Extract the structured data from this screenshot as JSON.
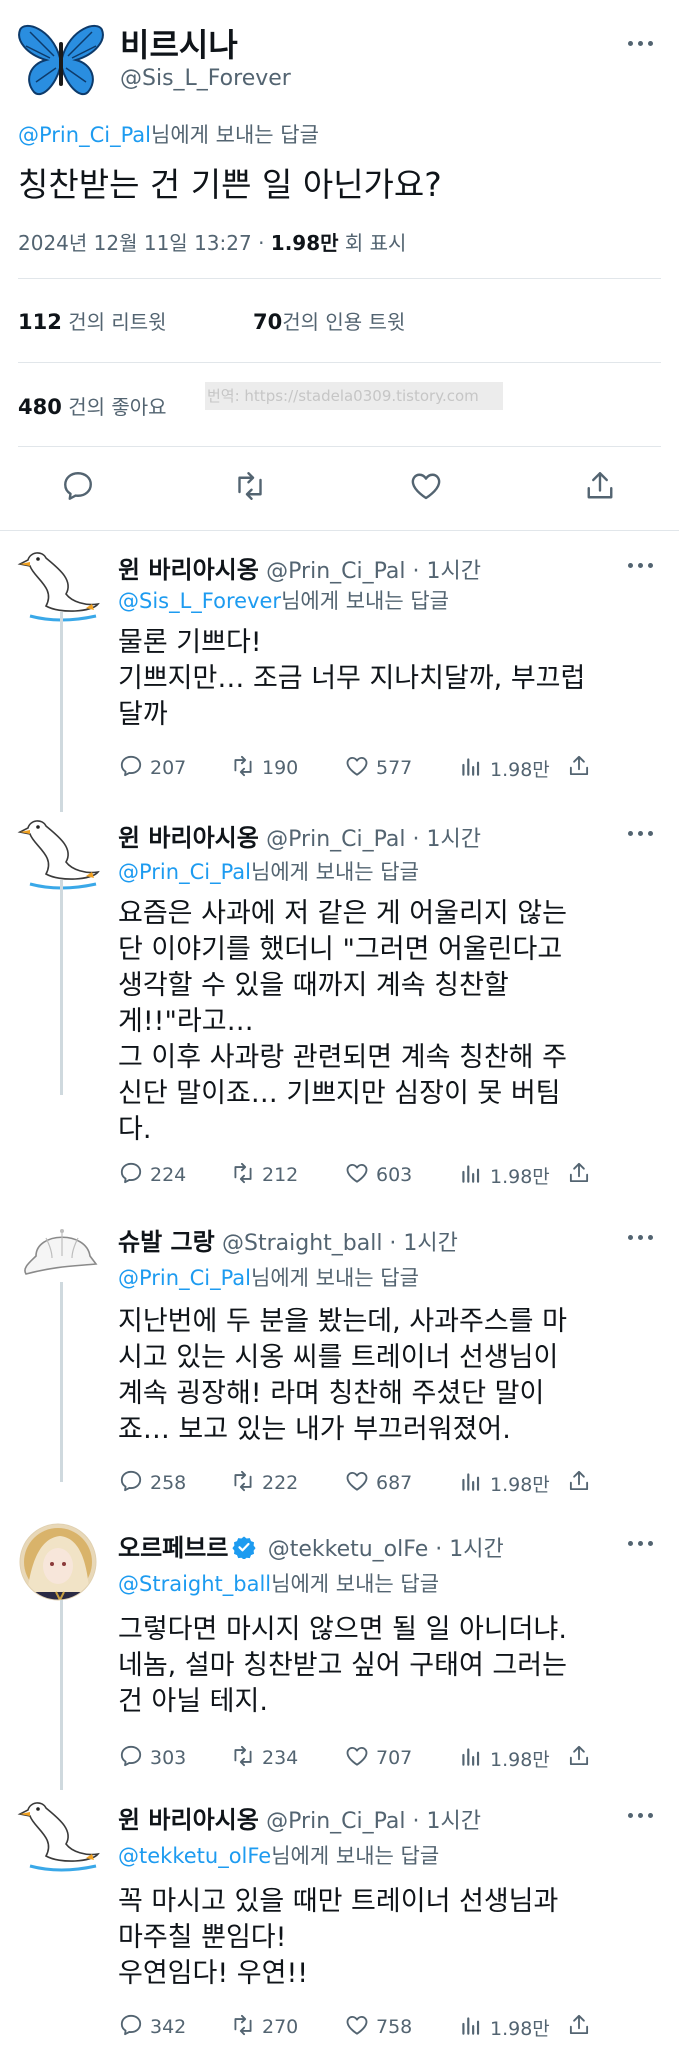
{
  "main_tweet": {
    "author_name": "비르시나",
    "author_handle": "@Sis_L_Forever",
    "reply_to_handle": "@Prin_Ci_Pal",
    "reply_to_suffix": "님에게 보내는 답글",
    "text": "칭찬받는 건 기쁜 일 아닌가요?",
    "timestamp": "2024년 12월 11일 13:27 · ",
    "views_count": "1.98만",
    "views_label": " 회 표시",
    "retweets_count": "112",
    "retweets_label": " 건의 리트윗",
    "quotes_count": "70",
    "quotes_label": "건의 인용 트윗",
    "likes_count": "480",
    "likes_label": " 건의 좋아요",
    "watermark": "번역: https://stadela0309.tistory.com"
  },
  "replies": [
    {
      "name": "윈 바리아시옹",
      "handle": "@Prin_Ci_Pal",
      "time": " · 1시간",
      "reply_to_handle": "@Sis_L_Forever",
      "reply_to_suffix": "님에게 보내는 답글",
      "text": "물론 기쁘다!\n기쁘지만… 조금 너무 지나치달까, 부끄럽\n달까",
      "replies": "207",
      "retweets": "190",
      "likes": "577",
      "views": "1.98만"
    },
    {
      "name": "윈 바리아시옹",
      "handle": "@Prin_Ci_Pal",
      "time": " · 1시간",
      "reply_to_handle": "@Prin_Ci_Pal",
      "reply_to_suffix": "님에게 보내는 답글",
      "text": "요즘은 사과에 저 같은 게 어울리지 않는\n단 이야기를 했더니 \"그러면 어울린다고\n생각할 수 있을 때까지 계속 칭찬할\n게!!\"라고…\n그 이후 사과랑 관련되면 계속 칭찬해 주\n신단 말이죠… 기쁘지만 심장이 못 버팀\n다.",
      "replies": "224",
      "retweets": "212",
      "likes": "603",
      "views": "1.98만"
    },
    {
      "name": "슈발 그랑",
      "handle": "@Straight_ball",
      "time": " · 1시간",
      "reply_to_handle": "@Prin_Ci_Pal",
      "reply_to_suffix": "님에게 보내는 답글",
      "text": "지난번에 두 분을 봤는데, 사과주스를 마\n시고 있는 시옹 씨를 트레이너 선생님이\n계속 굉장해! 라며 칭찬해 주셨단 말이\n죠… 보고 있는 내가 부끄러워졌어.",
      "replies": "258",
      "retweets": "222",
      "likes": "687",
      "views": "1.98만"
    },
    {
      "name": "오르페브르",
      "handle": "@tekketu_olFe",
      "time": " · 1시간",
      "reply_to_handle": "@Straight_ball",
      "reply_to_suffix": "님에게 보내는 답글",
      "text": "그렇다면 마시지 않으면 될 일 아니더냐.\n네놈, 설마 칭찬받고 싶어 구태여 그러는\n건 아닐 테지.",
      "replies": "303",
      "retweets": "234",
      "likes": "707",
      "views": "1.98만"
    },
    {
      "name": "윈 바리아시옹",
      "handle": "@Prin_Ci_Pal",
      "time": " · 1시간",
      "reply_to_handle": "@tekketu_olFe",
      "reply_to_suffix": "님에게 보내는 답글",
      "text": "꼭 마시고 있을 때만 트레이너 선생님과\n마주칠 뿐임다!\n우연임다! 우연!!",
      "replies": "342",
      "retweets": "270",
      "likes": "758",
      "views": "1.98만"
    }
  ],
  "icons": {
    "reply": "reply-icon",
    "retweet": "retweet-icon",
    "like": "heart-icon",
    "views": "views-icon",
    "share": "share-icon",
    "more": "more-icon",
    "verified": "verified-badge-icon"
  },
  "colors": {
    "link": "#1d9bf0",
    "secondary_text": "#536471",
    "verified": "#1d9bf0",
    "butterfly": "#2a8ee0"
  }
}
